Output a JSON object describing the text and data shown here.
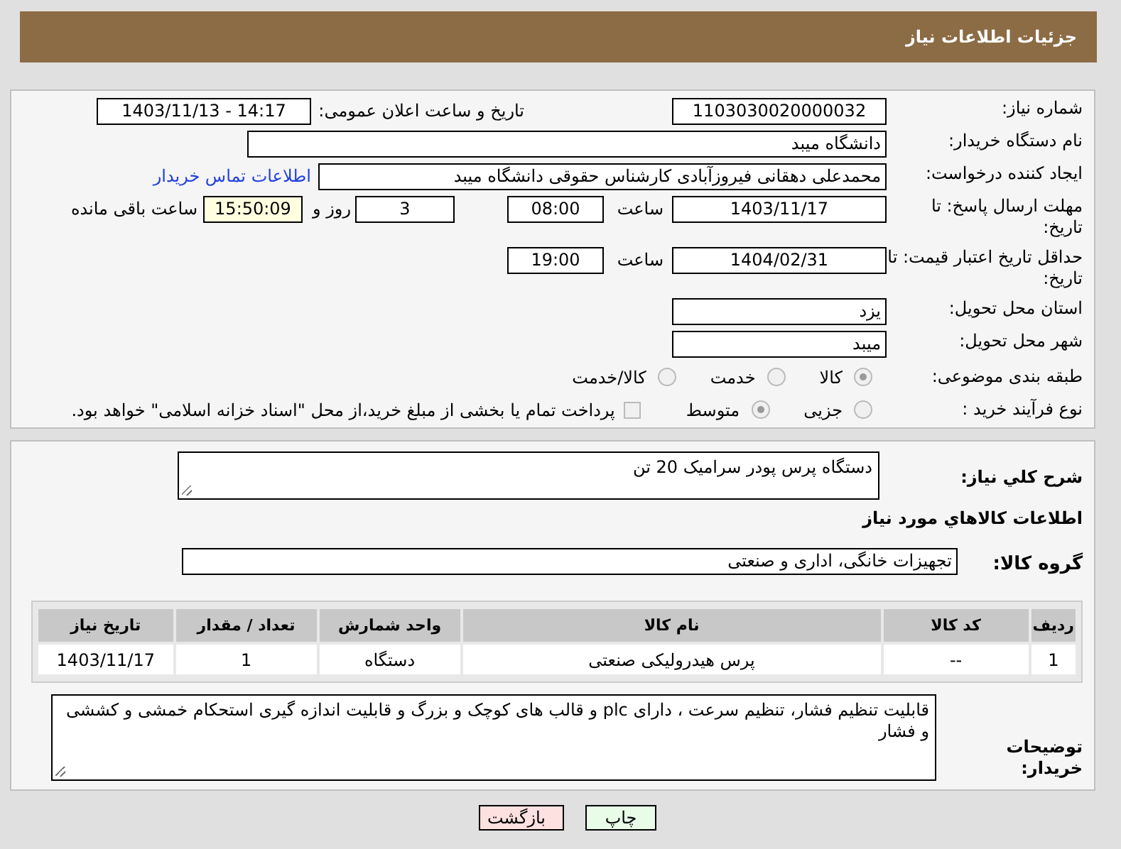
{
  "page_title": "جزئیات اطلاعات نیاز",
  "need_number": {
    "label": "شماره نیاز:",
    "value": "1103030020000032"
  },
  "announce": {
    "label": "تاریخ و ساعت اعلان عمومی:",
    "value": "1403/11/13 - 14:17"
  },
  "buyer": {
    "label": "نام دستگاه خریدار:",
    "value": "دانشگاه میبد"
  },
  "requester": {
    "label": "ایجاد کننده درخواست:",
    "value": "محمدعلی دهقانی فیروزآبادی کارشناس حقوقی دانشگاه میبد",
    "link": "اطلاعات تماس خریدار"
  },
  "reply_deadline": {
    "label": "مهلت ارسال پاسخ: تا تاریخ:",
    "date": "1403/11/17",
    "time_label": "ساعت",
    "time": "08:00",
    "days": "3",
    "days_label": "روز و",
    "remaining": "15:50:09",
    "remaining_label": "ساعت باقی مانده"
  },
  "price_validity": {
    "label": "حداقل تاریخ اعتبار قیمت: تا تاریخ:",
    "date": "1404/02/31",
    "time_label": "ساعت",
    "time": "19:00"
  },
  "province": {
    "label": "استان محل تحویل:",
    "value": "یزد"
  },
  "city": {
    "label": "شهر محل تحویل:",
    "value": "میبد"
  },
  "category": {
    "label": "طبقه بندی موضوعی:",
    "options": [
      {
        "label": "کالا",
        "selected": true
      },
      {
        "label": "خدمت",
        "selected": false
      },
      {
        "label": "کالا/خدمت",
        "selected": false
      }
    ]
  },
  "process": {
    "label": "نوع فرآیند خرید :",
    "options": [
      {
        "label": "جزیی",
        "selected": false
      },
      {
        "label": "متوسط",
        "selected": true
      }
    ],
    "payment": {
      "checked": false,
      "text": "پرداخت تمام یا بخشی از مبلغ خرید،از محل \"اسناد خزانه اسلامی\" خواهد بود."
    }
  },
  "description": {
    "label": "شرح کلي نياز:",
    "value": "دستگاه پرس پودر سرامیک 20 تن"
  },
  "goods_heading": "اطلاعات کالاهاي مورد نياز",
  "goods_group": {
    "label": "گروه کالا:",
    "value": "تجهیزات خانگی، اداری و صنعتی"
  },
  "table": {
    "columns": [
      "ردیف",
      "کد کالا",
      "نام کالا",
      "واحد شمارش",
      "تعداد / مقدار",
      "تاریخ نیاز"
    ],
    "rows": [
      [
        "1",
        "--",
        "پرس هیدرولیکی صنعتی",
        "دستگاه",
        "1",
        "1403/11/17"
      ]
    ]
  },
  "buyer_notes": {
    "label": "توضیحات خریدار:",
    "value": "قابلیت تنظیم فشار، تنظیم سرعت ، دارای plc و قالب های کوچک و بزرگ و قابلیت اندازه گیری استحکام خمشی و کششی و فشار"
  },
  "buttons": [
    {
      "label": "چاپ",
      "kind": "print"
    },
    {
      "label": "بازگشت",
      "kind": "back"
    }
  ]
}
